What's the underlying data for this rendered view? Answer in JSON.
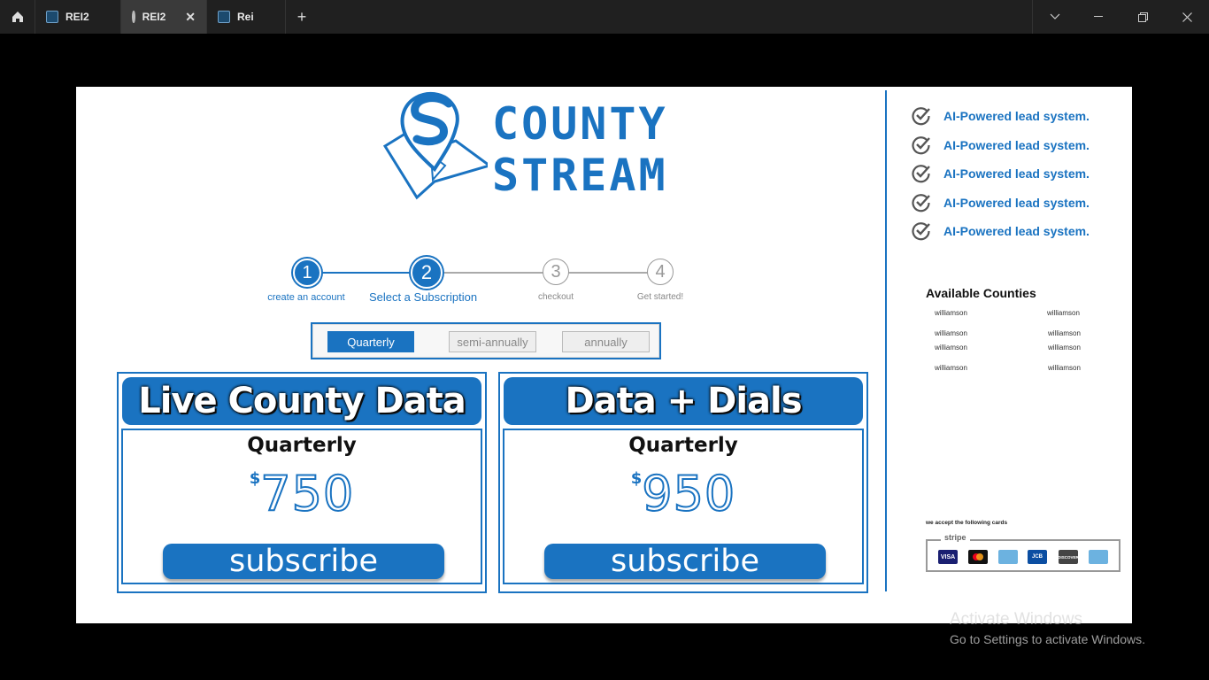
{
  "tabs": [
    {
      "label": "REI2",
      "icon": "app-icon",
      "active": false
    },
    {
      "label": "REI2",
      "icon": "play-icon",
      "active": true
    },
    {
      "label": "Rei",
      "icon": "app-icon",
      "active": false
    }
  ],
  "titlebar": {
    "close_tab": "✕",
    "new_tab": "+",
    "dropdown": "⌄",
    "minimize": "—",
    "restore": "❐",
    "close": "✕"
  },
  "logo": {
    "line1": "COUNTY",
    "line2": "STREAM"
  },
  "steps": [
    {
      "number": "1",
      "label": "create an account",
      "state": "done"
    },
    {
      "number": "2",
      "label": "Select a Subscription",
      "state": "current"
    },
    {
      "number": "3",
      "label": "checkout",
      "state": "todo"
    },
    {
      "number": "4",
      "label": "Get started!",
      "state": "todo"
    }
  ],
  "period_options": [
    "Quarterly",
    "semi-annually",
    "annually"
  ],
  "selected_period": "Quarterly",
  "plans": [
    {
      "title": "Live County Data",
      "period": "Quarterly",
      "currency": "$",
      "price": "750",
      "button": "subscribe"
    },
    {
      "title": "Data + Dials",
      "period": "Quarterly",
      "currency": "$",
      "price": "950",
      "button": "subscribe"
    }
  ],
  "features": [
    "AI-Powered lead system.",
    "AI-Powered lead system.",
    "AI-Powered lead system.",
    "AI-Powered lead system.",
    "AI-Powered lead system."
  ],
  "counties": {
    "title": "Available Counties",
    "items": [
      "williamson",
      "williamson",
      "williamson",
      "williamson",
      "williamson",
      "williamson",
      "williamson",
      "williamson"
    ]
  },
  "payment": {
    "label": "we accept the following cards",
    "provider": "stripe",
    "cards": [
      "VISA",
      "mastercard",
      "amex",
      "JCB",
      "DISCOVER",
      "amex"
    ]
  },
  "watermark": {
    "line1": "Activate Windows",
    "line2": "Go to Settings to activate Windows."
  },
  "colors": {
    "brand": "#1a73c1",
    "titlebar": "#202020"
  }
}
